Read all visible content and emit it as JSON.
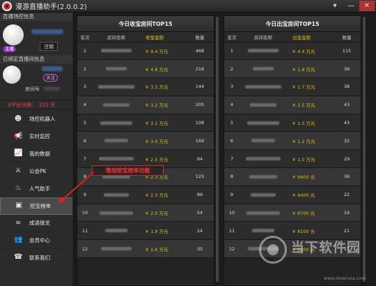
{
  "app": {
    "title": "漫游直播助手(2.0.0.2)",
    "window_controls": [
      "▾",
      "—",
      "✕"
    ]
  },
  "sidebar": {
    "host_section_title": "直播场控信息",
    "host_badge": "主播",
    "logout_label": "注销",
    "room_section_title": "已绑定直播间信息",
    "follow_badge": "关注",
    "room_id_label": "房间号",
    "vip_text": "VIP有效期： 352 天",
    "nav_items": [
      {
        "label": "场控机器人",
        "icon": "robot-icon",
        "glyph": "☻"
      },
      {
        "label": "实时监控",
        "icon": "megaphone-icon",
        "glyph": "📢"
      },
      {
        "label": "我的数据",
        "icon": "chart-icon",
        "glyph": "📈"
      },
      {
        "label": "公会PK",
        "icon": "swords-icon",
        "glyph": "⚔"
      },
      {
        "label": "人气助手",
        "icon": "flame-icon",
        "glyph": "♨"
      },
      {
        "label": "挖宝榜单",
        "icon": "monitor-icon",
        "glyph": "▣"
      },
      {
        "label": "成语接龙",
        "icon": "link-icon",
        "glyph": "∞"
      },
      {
        "label": "会员中心",
        "icon": "members-icon",
        "glyph": "👥"
      },
      {
        "label": "联系我们",
        "icon": "headset-icon",
        "glyph": "☎"
      }
    ],
    "active_index": 5
  },
  "left_panel": {
    "title": "今日收宝房间TOP15",
    "columns": [
      "名次",
      "房间名称",
      "收宝金额",
      "数量"
    ],
    "rows": [
      {
        "rank": "1",
        "amount": "9.4 万元",
        "count": "468"
      },
      {
        "rank": "2",
        "amount": "4.8 万元",
        "count": "216"
      },
      {
        "rank": "3",
        "amount": "3.3 万元",
        "count": "144"
      },
      {
        "rank": "4",
        "amount": "3.2 万元",
        "count": "205"
      },
      {
        "rank": "5",
        "amount": "3.1 万元",
        "count": "108"
      },
      {
        "rank": "6",
        "amount": "3.0 万元",
        "count": "169"
      },
      {
        "rank": "7",
        "amount": "2.5 万元",
        "count": "94"
      },
      {
        "rank": "8",
        "amount": "2.3 万元",
        "count": "123"
      },
      {
        "rank": "9",
        "amount": "2.3 万元",
        "count": "86"
      },
      {
        "rank": "10",
        "amount": "2.0 万元",
        "count": "54"
      },
      {
        "rank": "11",
        "amount": "1.9 万元",
        "count": "24"
      },
      {
        "rank": "12",
        "amount": "1.6 万元",
        "count": "30"
      }
    ]
  },
  "right_panel": {
    "title": "今日出宝房间TOP15",
    "columns": [
      "名次",
      "房间名称",
      "出宝金额",
      "数量"
    ],
    "rows": [
      {
        "rank": "1",
        "amount": "4.4 万元",
        "count": "115"
      },
      {
        "rank": "2",
        "amount": "1.8 万元",
        "count": "36"
      },
      {
        "rank": "3",
        "amount": "1.7 万元",
        "count": "38"
      },
      {
        "rank": "4",
        "amount": "1.5 万元",
        "count": "43"
      },
      {
        "rank": "5",
        "amount": "1.3 万元",
        "count": "43"
      },
      {
        "rank": "6",
        "amount": "1.2 万元",
        "count": "32"
      },
      {
        "rank": "7",
        "amount": "1.0 万元",
        "count": "29"
      },
      {
        "rank": "8",
        "amount": "9400 元",
        "count": "36"
      },
      {
        "rank": "9",
        "amount": "9400 元",
        "count": "22"
      },
      {
        "rank": "10",
        "amount": "8700 元",
        "count": "19"
      },
      {
        "rank": "11",
        "amount": "8100 元",
        "count": "21"
      },
      {
        "rank": "12",
        "amount": "6200 元",
        "count": "17"
      }
    ]
  },
  "annotation": {
    "text": "增加挖宝榜单功能",
    "color": "#e02020"
  },
  "watermark": {
    "text": "当下软件园",
    "url": "www.downxia.com"
  },
  "colors": {
    "accent_amount": "#e0c020",
    "vip_red": "#e04040",
    "host_badge": "#8a2bb5"
  }
}
